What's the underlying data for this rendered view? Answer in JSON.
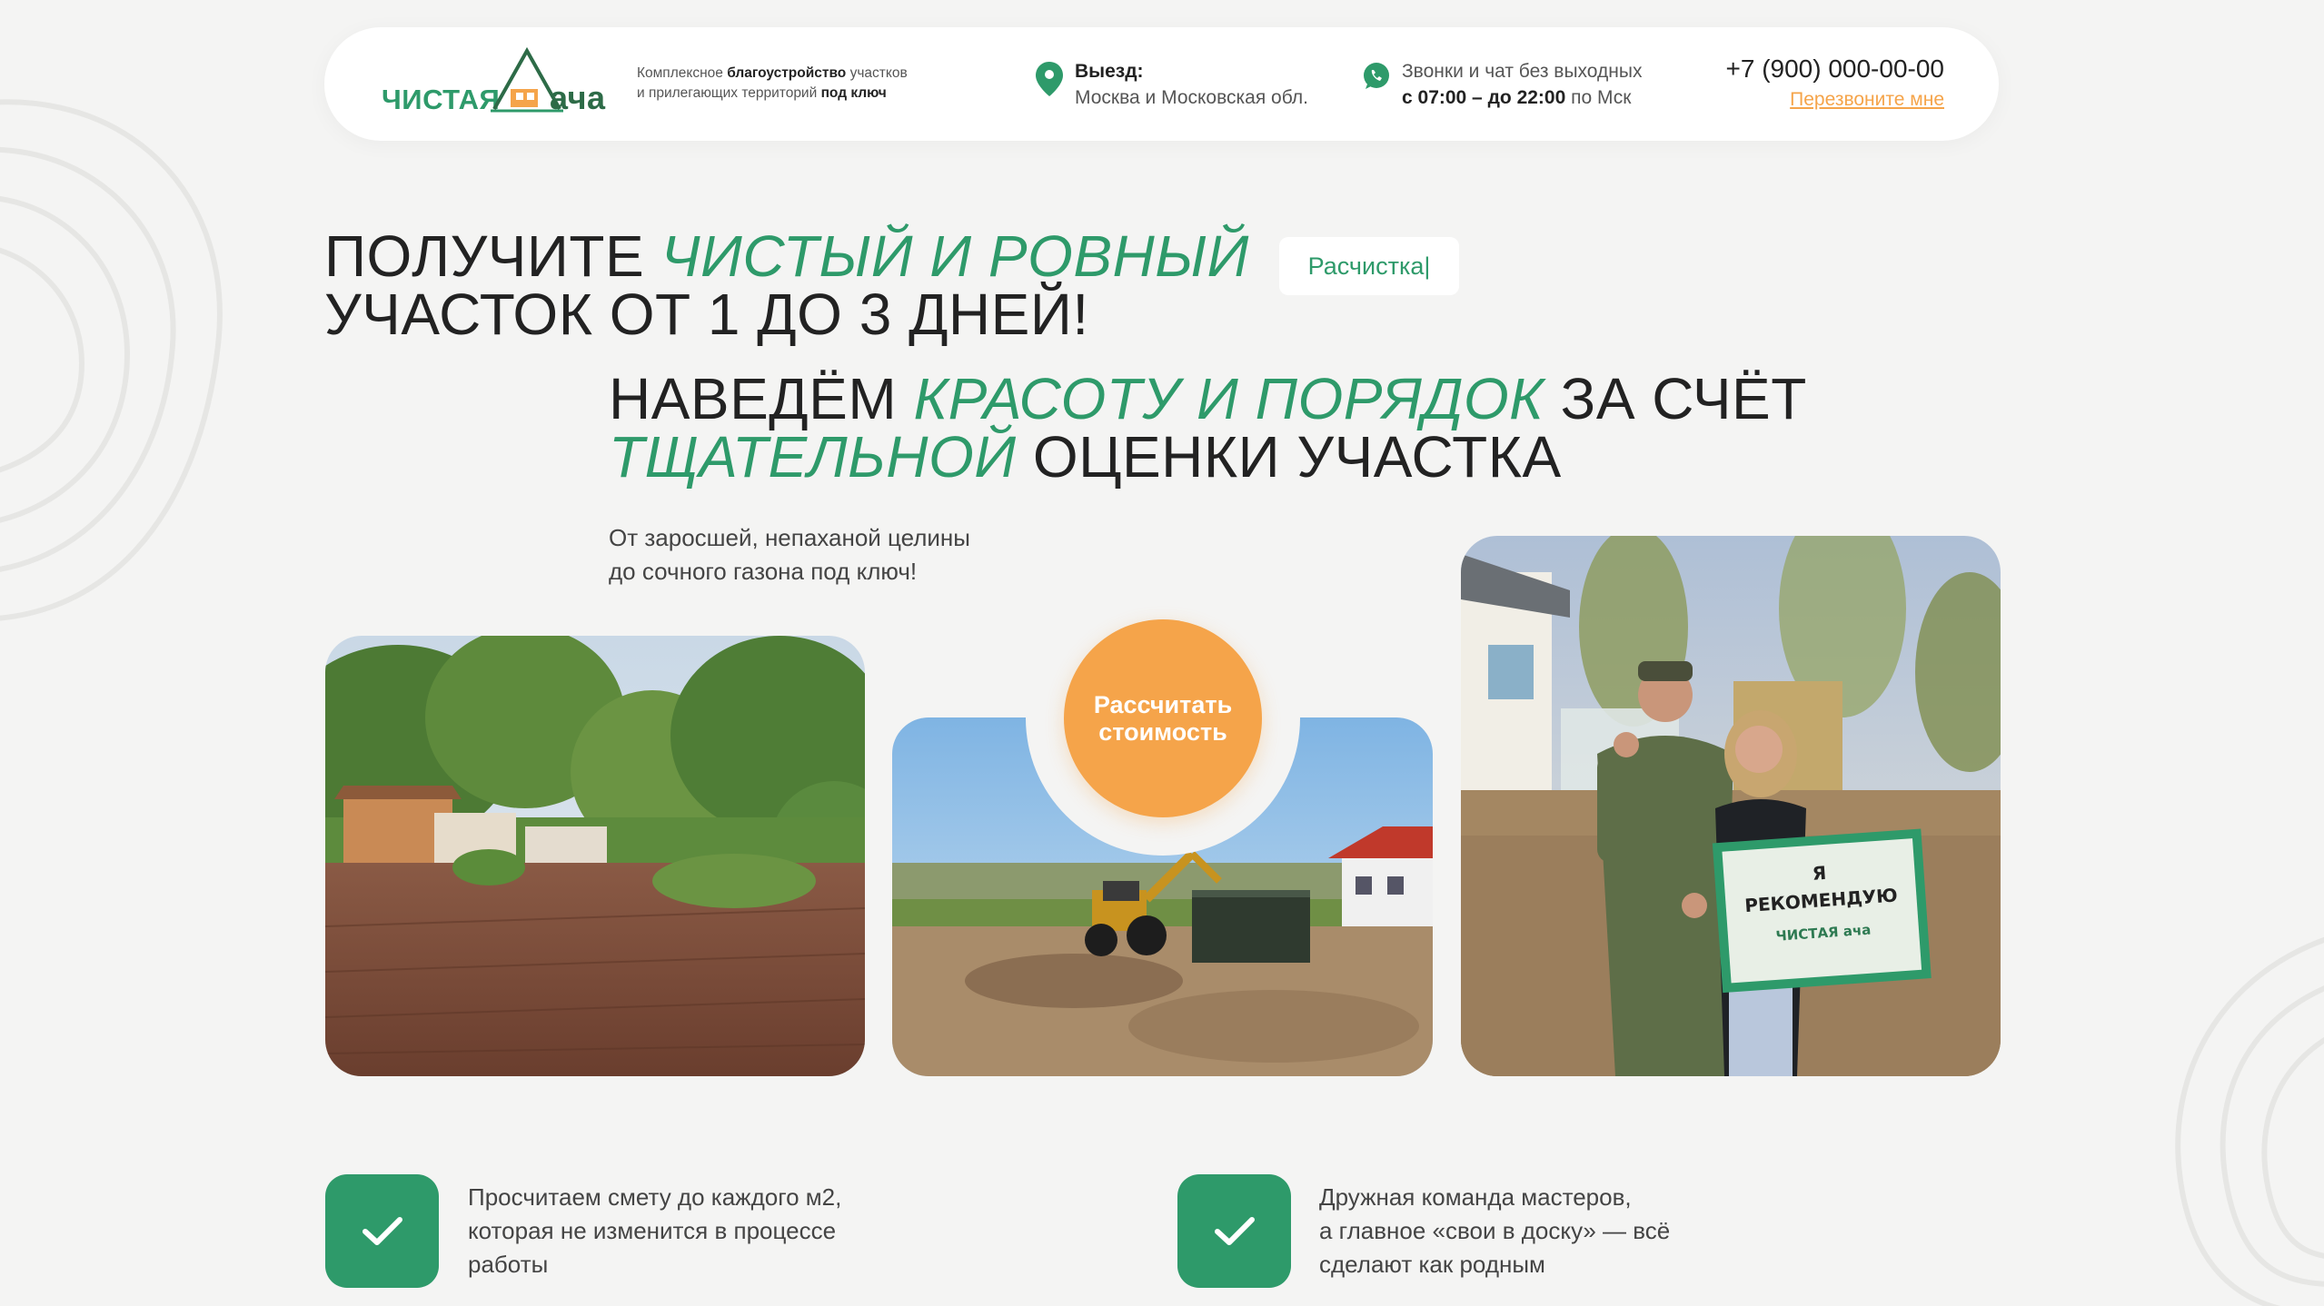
{
  "header": {
    "logo": {
      "part1": "ЧИСТАЯ",
      "part2": "ача"
    },
    "tagline": {
      "line1_pre": "Комплексное ",
      "line1_bold": "благоустройство",
      "line1_post": " участков",
      "line2_pre": "и прилегающих территорий ",
      "line2_bold": "под ключ"
    },
    "location": {
      "label": "Выезд:",
      "value": "Москва и Московская обл."
    },
    "hours": {
      "line1": "Звонки и чат без выходных",
      "line2_bold": "с 07:00 – до 22:00",
      "line2_post": " по Мск"
    },
    "phone": "+7 (900) 000-00-00",
    "callback_label": "Перезвоните мне"
  },
  "hero": {
    "title_l1_pre": "ПОЛУЧИТЕ ",
    "title_l1_accent": "ЧИСТЫЙ И РОВНЫЙ",
    "title_l2": "УЧАСТОК ОТ 1 ДО 3 ДНЕЙ!",
    "rotating_tag": "Расчистка|",
    "subtitle_l1_pre": "НАВЕДЁМ ",
    "subtitle_l1_accent": "КРАСОТУ И ПОРЯДОК",
    "subtitle_l1_post": " ЗА СЧЁТ",
    "subtitle_l2_accent": "ТЩАТЕЛЬНОЙ",
    "subtitle_l2_post": " ОЦЕНКИ УЧАСТКА",
    "desc_l1": "От заросшей, непаханой целины",
    "desc_l2": "до сочного газона под ключ!",
    "cta_l1": "Рассчитать",
    "cta_l2": "стоимость"
  },
  "sign": {
    "line1": "Я",
    "line2": "РЕКОМЕНДУЮ",
    "logo": "ЧИСТАЯ ача"
  },
  "features": [
    {
      "lines": [
        "Просчитаем смету до каждого м2,",
        "которая не изменится в процессе",
        "работы"
      ]
    },
    {
      "lines": [
        "Дружная команда мастеров,",
        "а главное «свои в доску» — всё",
        "сделают как родным"
      ]
    }
  ],
  "colors": {
    "accent_green": "#2e9a6a",
    "accent_orange": "#f5a44a",
    "background": "#f4f4f3"
  }
}
